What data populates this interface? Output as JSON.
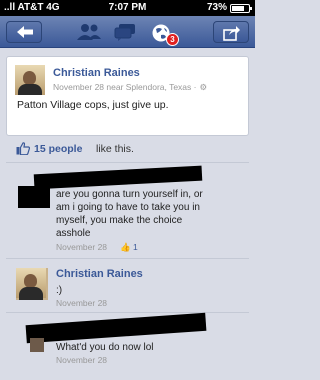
{
  "status_bar": {
    "signal": "..ll AT&T 4G",
    "time": "7:07 PM",
    "battery": "73%",
    "battery_level": 0.73
  },
  "nav": {
    "notification_count": "3"
  },
  "post": {
    "author": "Christian Raines",
    "meta": "November 28 near Splendora, Texas ·",
    "text": "Patton Village cops, just give up."
  },
  "likes": {
    "count": "15 people",
    "suffix": "like this."
  },
  "comments": [
    {
      "text_lines": [
        "are you gonna turn yourself in, or",
        "am i going to have to take you in",
        "myself, you make the choice",
        "asshole"
      ],
      "date": "November 28",
      "likes": "1"
    },
    {
      "author": "Christian Raines",
      "text": ":)",
      "date": "November 28"
    },
    {
      "text": "What'd you do now lol",
      "date": "November 28"
    }
  ],
  "colors": {
    "brand_blue": "#3b5998",
    "background": "#d9dce6",
    "badge_red": "#e02020"
  },
  "icons": [
    "back-arrow-icon",
    "friends-icon",
    "messages-icon",
    "globe-notifications-icon",
    "share-icon",
    "like-thumb-icon"
  ]
}
